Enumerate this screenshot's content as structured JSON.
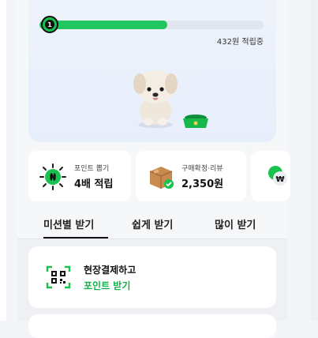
{
  "progress": {
    "level": "1",
    "fill_fraction": 0.57,
    "status_text": "432원 적립중"
  },
  "colors": {
    "accent_green": "#22c55e",
    "link_green": "#12b24a"
  },
  "benefit_cards": [
    {
      "icon": "point-coin-icon",
      "subtitle": "포인트 뽑기",
      "title": "4배 적립"
    },
    {
      "icon": "delivery-box-icon",
      "subtitle": "구매확정·리뷰",
      "title": "2,350원"
    },
    {
      "icon": "won-coin-icon"
    }
  ],
  "tabs": [
    {
      "label": "미션별 받기",
      "active": true
    },
    {
      "label": "쉽게 받기",
      "active": false
    },
    {
      "label": "많이 받기",
      "active": false
    }
  ],
  "missions": [
    {
      "icon": "qr-scan-icon",
      "title": "현장결제하고",
      "action": "포인트 받기"
    }
  ]
}
